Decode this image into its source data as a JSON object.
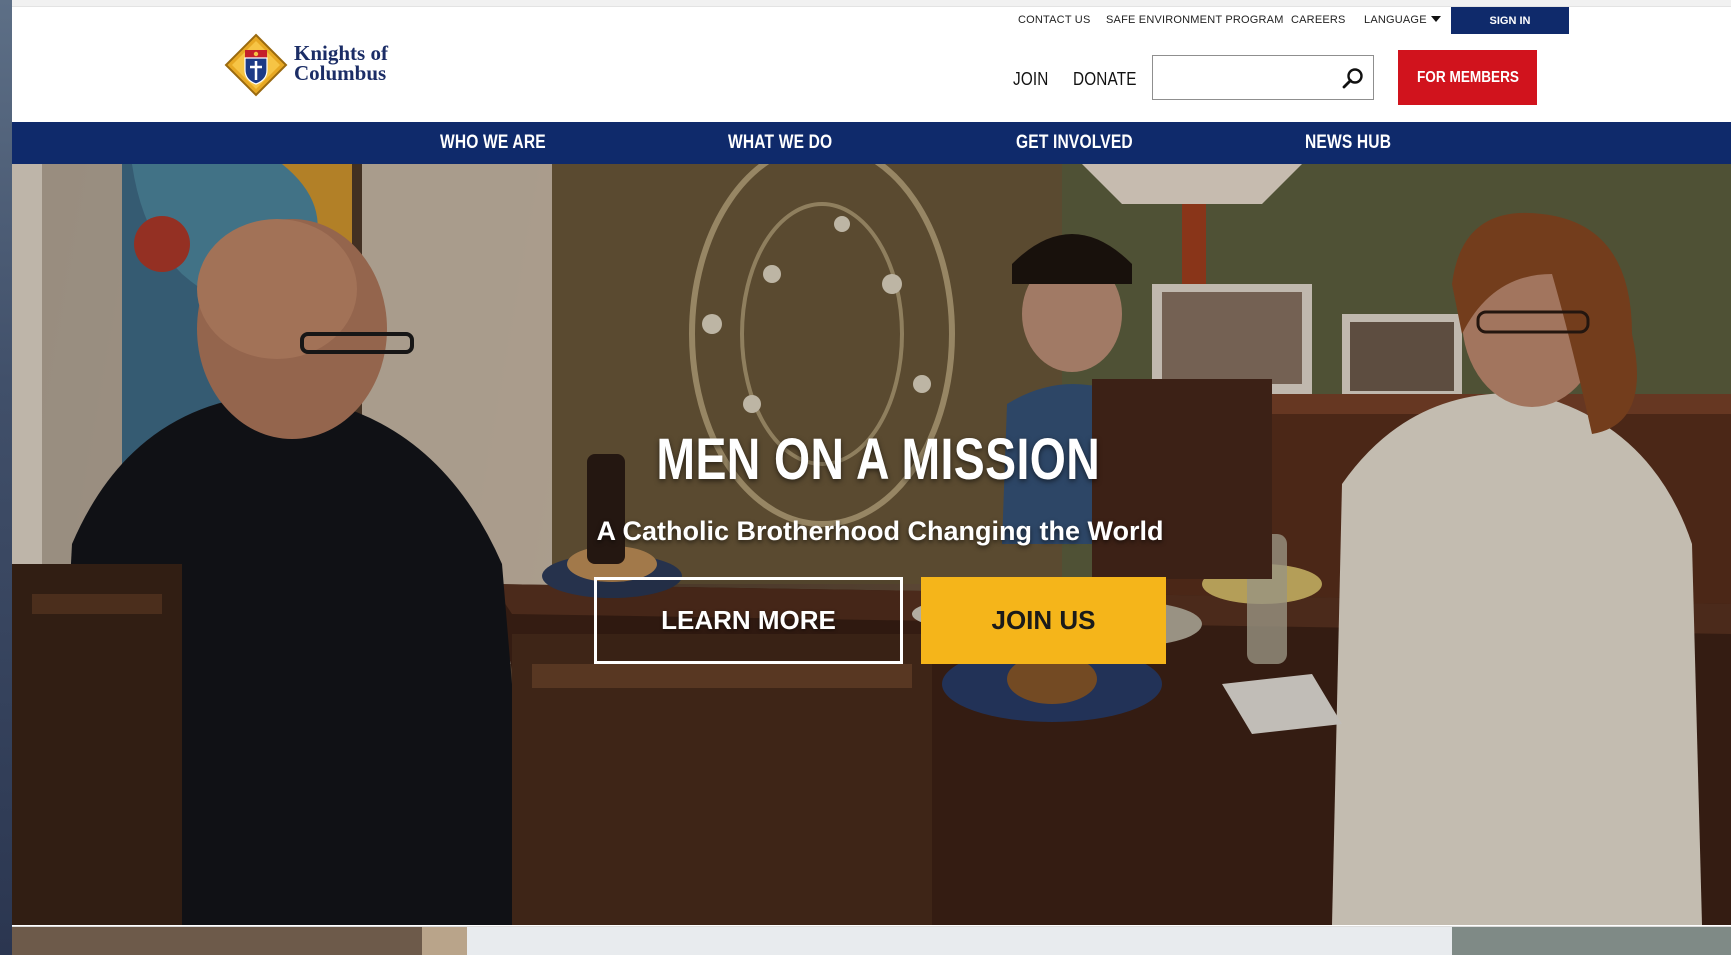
{
  "utility_nav": {
    "contact": "CONTACT US",
    "safe_env": "SAFE ENVIRONMENT PROGRAM",
    "careers": "CAREERS",
    "language": "LANGUAGE",
    "sign_in": "SIGN IN"
  },
  "logo": {
    "line1": "Knights of",
    "line2": "Columbus",
    "emblem_icon": "kofc-emblem-icon"
  },
  "header": {
    "join": "JOIN",
    "donate": "DONATE",
    "search_placeholder": "",
    "search_icon": "search-icon",
    "for_members": "FOR MEMBERS"
  },
  "main_nav": {
    "items": [
      "WHO WE ARE",
      "WHAT WE DO",
      "GET INVOLVED",
      "NEWS HUB"
    ]
  },
  "hero": {
    "title": "MEN ON A MISSION",
    "subtitle": "A Catholic Brotherhood Changing the World",
    "learn_more": "LEARN MORE",
    "join_us": "JOIN US"
  },
  "colors": {
    "navy": "#0f2a6b",
    "red": "#d1131d",
    "gold": "#f5b51a"
  }
}
